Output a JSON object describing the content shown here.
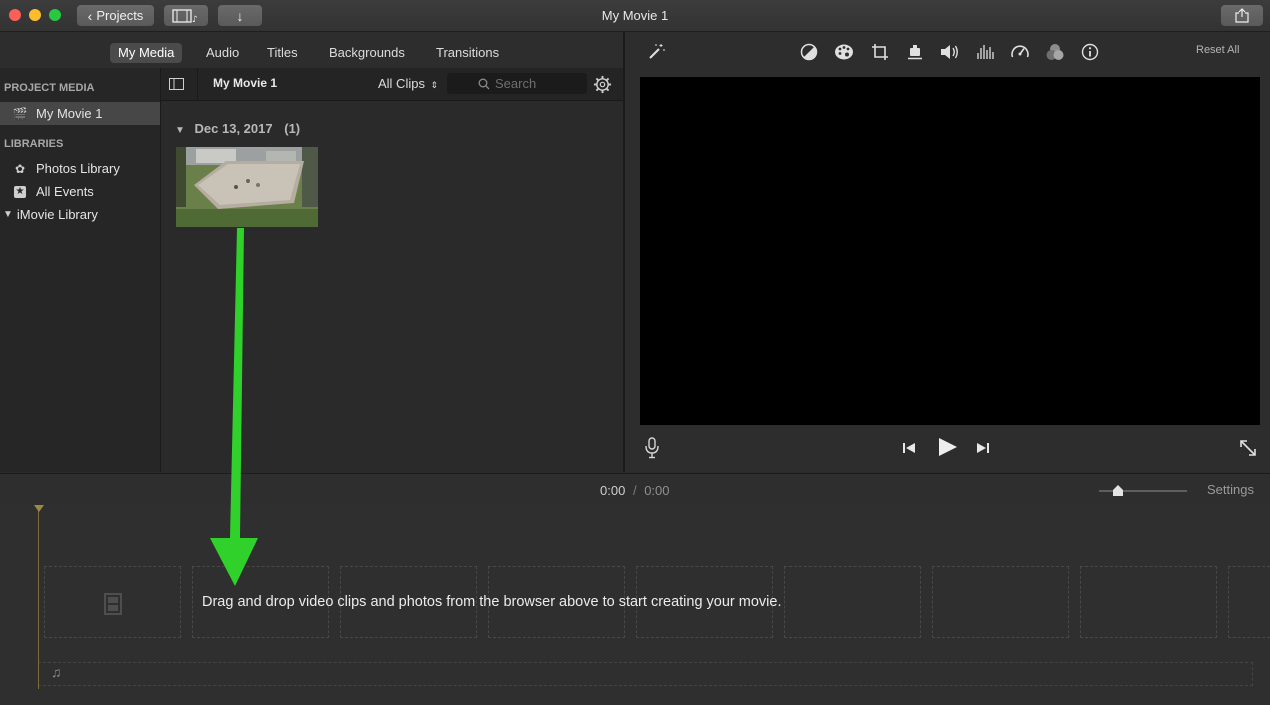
{
  "titlebar": {
    "title": "My Movie 1",
    "projects_label": "Projects",
    "traffic_colors": [
      "#fc5f57",
      "#fdbc2e",
      "#28c840"
    ]
  },
  "media_tabs": [
    {
      "label": "My Media",
      "active": true
    },
    {
      "label": "Audio",
      "active": false
    },
    {
      "label": "Titles",
      "active": false
    },
    {
      "label": "Backgrounds",
      "active": false
    },
    {
      "label": "Transitions",
      "active": false
    }
  ],
  "sidebar": {
    "project_media_heading": "PROJECT MEDIA",
    "project_item": "My Movie 1",
    "libraries_heading": "LIBRARIES",
    "photos_library": "Photos Library",
    "all_events": "All Events",
    "imovie_library": "iMovie Library"
  },
  "browser": {
    "project_name": "My Movie 1",
    "filter_label": "All Clips",
    "search_placeholder": "Search",
    "date_group": "Dec 13, 2017",
    "date_count": "(1)"
  },
  "viewer": {
    "reset_all": "Reset All",
    "tool_icons": [
      "color-balance-icon",
      "color-correction-icon",
      "crop-icon",
      "stabilization-icon",
      "volume-icon",
      "equalizer-icon",
      "speed-icon",
      "clip-filter-icon",
      "info-icon"
    ]
  },
  "timeline": {
    "current_time": "0:00",
    "separator": "/",
    "total_time": "0:00",
    "settings_label": "Settings",
    "zoom_level": 0.22,
    "drop_message": "Drag and drop video clips and photos from the browser above to start creating your movie."
  },
  "colors": {
    "annotation_arrow": "#2fd12a",
    "video_background": "#000000"
  }
}
